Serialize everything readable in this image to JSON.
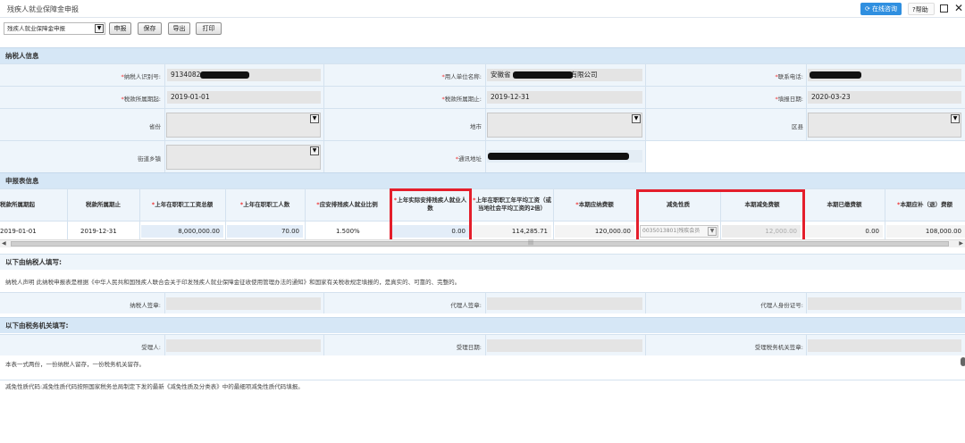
{
  "window": {
    "title": "残疾人就业保障金申报",
    "online_consult": "在线咨询",
    "help": "帮助"
  },
  "toolbar": {
    "form_select": "残疾人就业保障金申报",
    "buttons": [
      "申报",
      "保存",
      "导出",
      "打印"
    ]
  },
  "taxpayer_section": {
    "title": "纳税人信息",
    "fields": {
      "taxpayer_id_label": "纳税人识别号:",
      "taxpayer_id_value": "91340824",
      "employer_name_label": "用人单位名称:",
      "employer_name_prefix": "安徽省",
      "employer_name_suffix": "有限公司",
      "phone_label": "联系电话:",
      "period_start_label": "税款所属期起:",
      "period_start_value": "2019-01-01",
      "period_end_label": "税款所属期止:",
      "period_end_value": "2019-12-31",
      "fill_date_label": "填报日期:",
      "fill_date_value": "2020-03-23",
      "province_label": "省份",
      "city_label": "地市",
      "district_label": "区县",
      "street_label": "街道乡镇",
      "address_label": "通讯地址"
    }
  },
  "declaration_section": {
    "title": "申报表信息",
    "headers": [
      {
        "text": "税款所属期起",
        "required": false
      },
      {
        "text": "税款所属期止",
        "required": false
      },
      {
        "text": "上年在职职工工资总额",
        "required": true
      },
      {
        "text": "上年在职职工人数",
        "required": true
      },
      {
        "text": "应安排残疾人就业比例",
        "required": true
      },
      {
        "text": "上年实际安排残疾人就业人数",
        "required": true
      },
      {
        "text": "上年在职职工年平均工资（或当地社会平均工资的2倍）",
        "required": true
      },
      {
        "text": "本期应纳费额",
        "required": true
      },
      {
        "text": "减免性质",
        "required": false
      },
      {
        "text": "本期减免费额",
        "required": false
      },
      {
        "text": "本期已缴费额",
        "required": false
      },
      {
        "text": "本期应补（退）费额",
        "required": true
      }
    ],
    "row": {
      "period_start": "2019-01-01",
      "period_end": "2019-12-31",
      "total_wages": "8,000,000.00",
      "employee_count": "70.00",
      "ratio": "1.500%",
      "disabled_employed": "0.00",
      "avg_salary": "114,285.71",
      "payable": "120,000.00",
      "relief_nature": "0035013801|残疾会员",
      "relief_amount": "12,000.00",
      "paid": "0.00",
      "refund_due": "108,000.00"
    }
  },
  "taxpayer_fill": {
    "title": "以下由纳税人填写:",
    "statement": "纳税人声明  此纳税申报表是根据《中华人民共和国残疾人联合会关于印发残疾人就业保障金征收使用管理办法的通知》和国家有关税收规定填报的，是真实的、可靠的、完整的。",
    "sign_label": "纳税人签章:",
    "agent_label": "代理人签章:",
    "agent_id_label": "代理人身份证号:"
  },
  "tax_office_fill": {
    "title": "以下由税务机关填写:",
    "receiver_label": "受理人:",
    "receive_date_label": "受理日期:",
    "office_seal_label": "受理税务机关签章:"
  },
  "notes": {
    "copies": "本表一式两份，一份纳税人留存，一份税务机关留存。",
    "relief_code": "减免性质代码:减免性质代码按照国家税务总局制定下发的最新《减免性质及分类表》中的最细项减免性质代码填报。"
  },
  "scrollbar": {
    "grip": "|||"
  }
}
